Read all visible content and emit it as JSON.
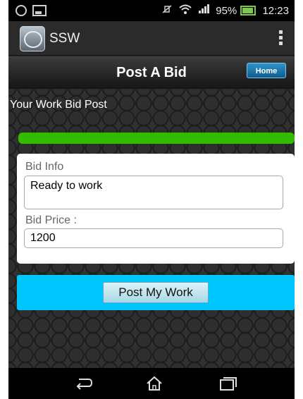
{
  "status_bar": {
    "wifi_icon": "wifi-icon",
    "signal_icon": "signal-icon",
    "battery": "95%",
    "time": "12:23"
  },
  "action_bar": {
    "app_name": "SSW"
  },
  "header": {
    "title": "Post A Bid",
    "home_label": "Home"
  },
  "content": {
    "section_title": "Your Work Bid Post",
    "progress": 1.0,
    "bid_info_label": "Bid Info",
    "bid_info_value": "Ready to work",
    "bid_price_label": "Bid Price :",
    "bid_price_value": "1200",
    "post_button_label": "Post My Work"
  },
  "colors": {
    "progress": "#33bb00",
    "post_panel": "#00c6ff",
    "home_button": "#1f77ad"
  }
}
